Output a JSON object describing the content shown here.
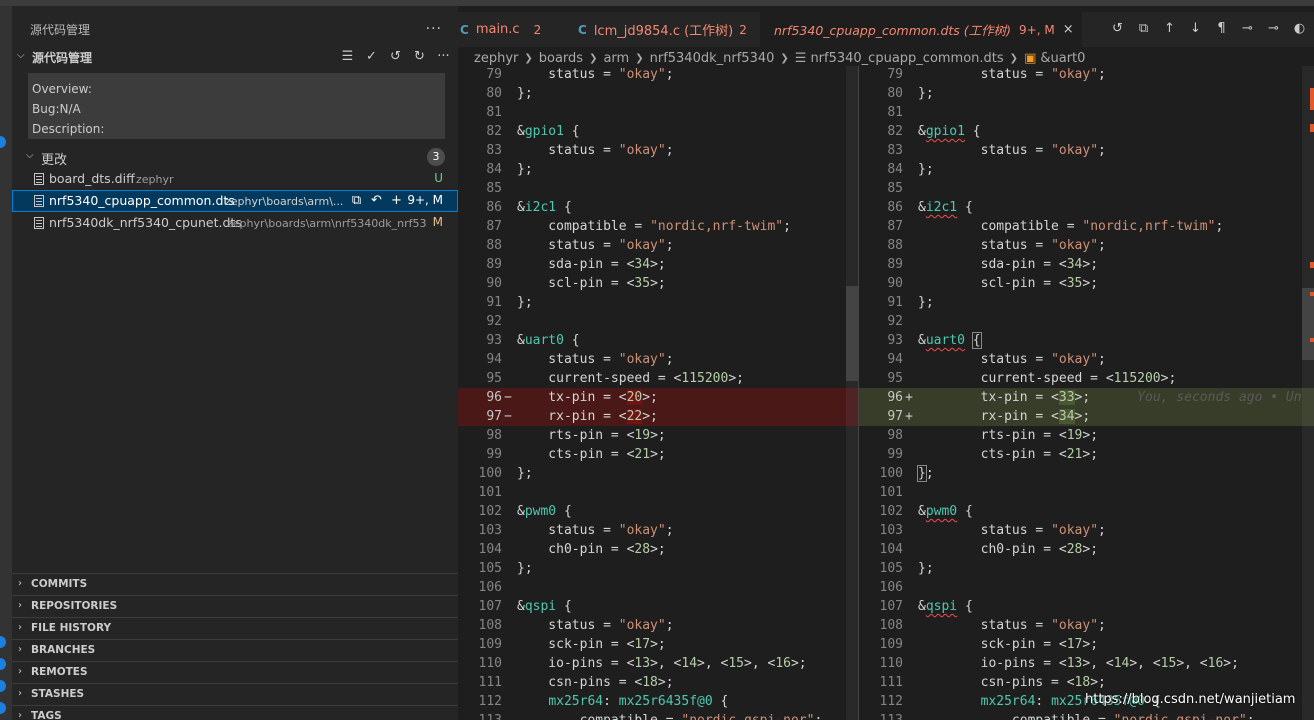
{
  "sidebar": {
    "title": "源代码管理",
    "more": "···",
    "section_title": "源代码管理",
    "commit_message": [
      "Overview:",
      "Bug:N/A",
      "Description:"
    ],
    "changes_label": "更改",
    "changes_count": "3",
    "files": [
      {
        "name": "board_dts.diff",
        "path": "zephyr",
        "status": "U",
        "status_color": "#73c991"
      },
      {
        "name": "nrf5340_cpuapp_common.dts",
        "path": "zephyr\\boards\\arm\\...",
        "status": "9+, M",
        "status_color": "#ffffff"
      },
      {
        "name": "nrf5340dk_nrf5340_cpunet.dts",
        "path": "zephyr\\boards\\arm\\nrf5340dk_nrf53...",
        "status": "M",
        "status_color": "#e2c08d"
      }
    ],
    "panels": [
      "COMMITS",
      "REPOSITORIES",
      "FILE HISTORY",
      "BRANCHES",
      "REMOTES",
      "STASHES",
      "TAGS"
    ]
  },
  "tabs": [
    {
      "icon": "C",
      "label": "main.c",
      "count": "2"
    },
    {
      "icon": "C",
      "label": "lcm_jd9854.c (工作树)",
      "count": "2"
    },
    {
      "icon": "",
      "label": "nrf5340_cpuapp_common.dts (工作树)",
      "count": "9+, M",
      "close": "×"
    }
  ],
  "breadcrumb": [
    "zephyr",
    "boards",
    "arm",
    "nrf5340dk_nrf5340",
    "nrf5340_cpuapp_common.dts",
    "&uart0"
  ],
  "blame_text": "You, seconds ago • Un",
  "watermark": "https://blog.csdn.net/wanjietiam",
  "colors": {
    "deleted": "#4b1818",
    "added": "#373d29",
    "accent": "#007fd4"
  }
}
